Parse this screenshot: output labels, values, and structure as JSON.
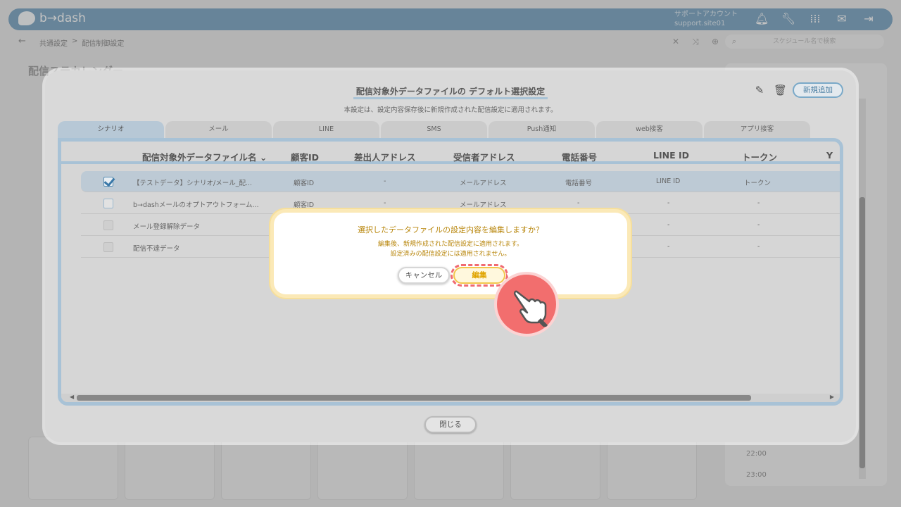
{
  "app": {
    "logo_text": "b→dash",
    "account_label": "サポートアカウント",
    "account_id": "support.site01",
    "top_icons": [
      "bell-icon",
      "wrench-icon",
      "grid-icon",
      "chat-icon",
      "logout-icon"
    ]
  },
  "subbar": {
    "back": "←",
    "breadcrumb": [
      "共通設定",
      ">",
      "配信制御設定"
    ],
    "search_placeholder": "スケジュール名で検索"
  },
  "background": {
    "page_title": "配信ステカレンダー",
    "times": [
      "22:00",
      "23:00"
    ]
  },
  "modal": {
    "title": "配信対象外データファイルの デフォルト選択設定",
    "subtitle": "本設定は、設定内容保存後に新規作成された配信設定に適用されます。",
    "add_button": "新規追加",
    "close_button": "閉じる",
    "tabs": [
      {
        "label": "シナリオ",
        "active": true
      },
      {
        "label": "メール",
        "active": false
      },
      {
        "label": "LINE",
        "active": false
      },
      {
        "label": "SMS",
        "active": false
      },
      {
        "label": "Push通知",
        "active": false
      },
      {
        "label": "web接客",
        "active": false
      },
      {
        "label": "アプリ接客",
        "active": false
      }
    ],
    "columns": [
      "配信対象外データファイル名",
      "顧客ID",
      "差出人アドレス",
      "受信者アドレス",
      "電話番号",
      "LINE ID",
      "トークン",
      "Y"
    ],
    "rows": [
      {
        "checked": true,
        "cells": [
          "【テストデータ】シナリオ/メール_配...",
          "顧客ID",
          "-",
          "メールアドレス",
          "電話番号",
          "LINE ID",
          "トークン"
        ]
      },
      {
        "checked": false,
        "cells": [
          "b→dashメールのオプトアウトフォーム...",
          "顧客ID",
          "-",
          "メールアドレス",
          "-",
          "-",
          "-"
        ]
      },
      {
        "checked": false,
        "cells": [
          "メール登録解除データ",
          "",
          "",
          "",
          "",
          "-",
          "-"
        ]
      },
      {
        "checked": false,
        "cells": [
          "配信不達データ",
          "",
          "",
          "",
          "",
          "-",
          "-"
        ]
      }
    ]
  },
  "dialog": {
    "title": "選択したデータファイルの設定内容を編集しますか？",
    "message_line1": "編集後、新規作成された配信設定に適用されます。",
    "message_line2": "設定済みの配信設定には適用されません。",
    "cancel_button": "キャンセル",
    "confirm_button": "編集"
  },
  "colors": {
    "brand": "#5a8fb4",
    "dialog_text": "#b8860b",
    "highlight": "#f06b72"
  }
}
